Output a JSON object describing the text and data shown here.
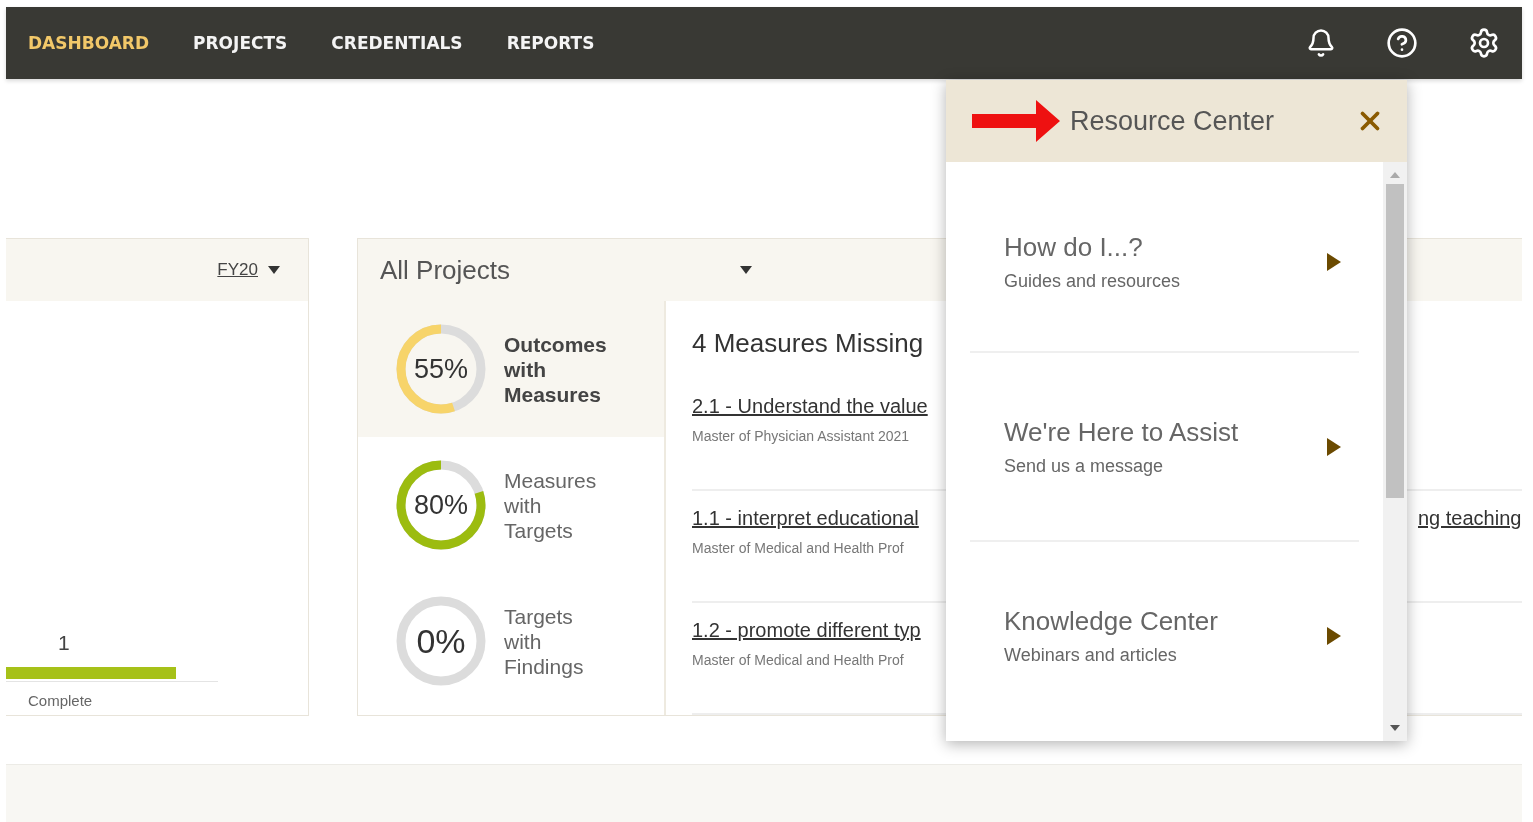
{
  "nav": {
    "items": [
      {
        "label": "DASHBOARD",
        "selected": true
      },
      {
        "label": "PROJECTS",
        "selected": false
      },
      {
        "label": "CREDENTIALS",
        "selected": false
      },
      {
        "label": "REPORTS",
        "selected": false
      }
    ]
  },
  "summary_card": {
    "period": "FY20",
    "count": "1",
    "level": 0.8,
    "caption": "Complete"
  },
  "projects_card": {
    "title": "All Projects",
    "stats": [
      {
        "percent": "55%",
        "label": "Outcomes with Measures",
        "color": "#f7d46a",
        "selected": true
      },
      {
        "percent": "80%",
        "label": "Measures with Targets",
        "color": "#9cbc10",
        "selected": false
      },
      {
        "percent": "0%",
        "label": "Targets with Findings",
        "selected": false
      }
    ],
    "missing_title": "4 Measures Missing",
    "measures": [
      {
        "title": "2.1 - Understand the value",
        "program": "Master of Physician Assistant 2021"
      },
      {
        "title": "1.1 - interpret educational",
        "program": "Master of Medical and Health Prof",
        "title_tail": "ng teaching"
      },
      {
        "title": "1.2 - promote different typ",
        "program": "Master of Medical and Health Prof"
      }
    ]
  },
  "resource_center": {
    "title": "Resource Center",
    "items": [
      {
        "title": "How do I...?",
        "subtitle": "Guides and resources"
      },
      {
        "title": "We're Here to Assist",
        "subtitle": "Send us a message"
      },
      {
        "title": "Knowledge Center",
        "subtitle": "Webinars and articles"
      }
    ]
  }
}
